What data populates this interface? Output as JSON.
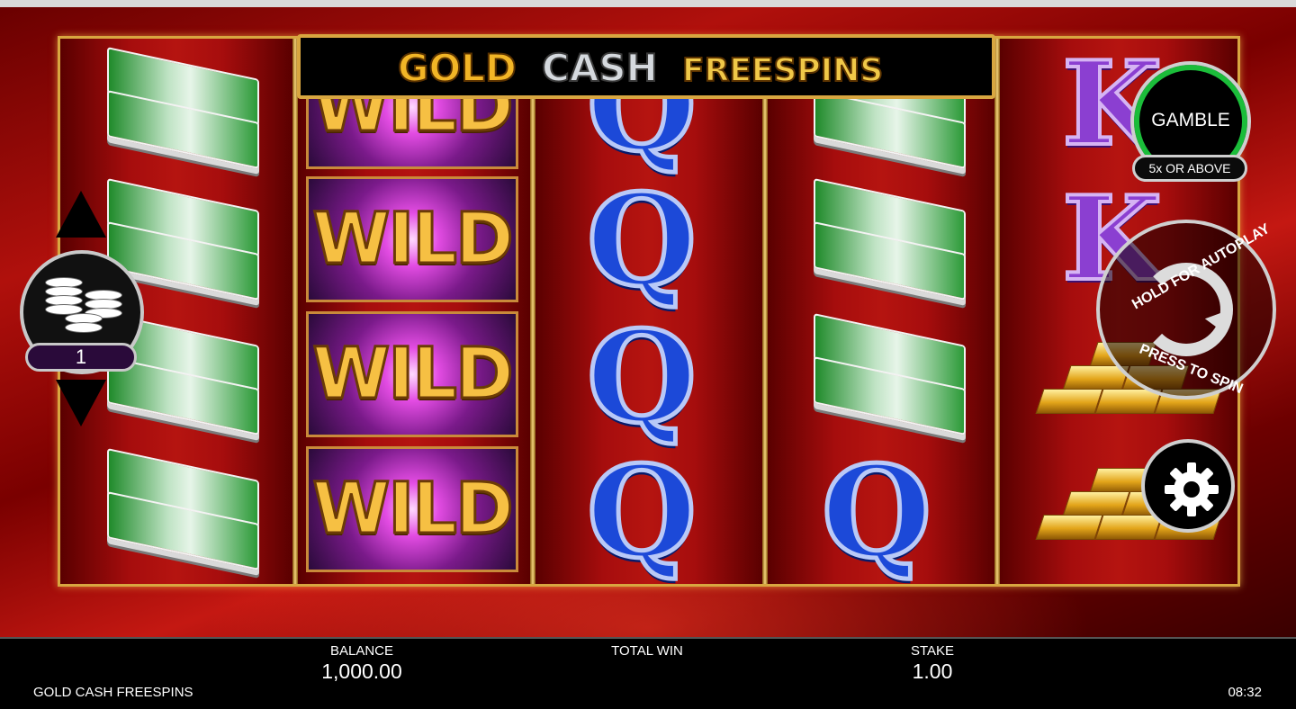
{
  "banner": {
    "word1": "GOLD",
    "word2": "CASH",
    "word3": "FREESPINS"
  },
  "reels": [
    [
      "cash",
      "cash",
      "cash",
      "cash"
    ],
    [
      "wild",
      "wild",
      "wild",
      "wild"
    ],
    [
      "q",
      "q",
      "q",
      "q"
    ],
    [
      "cash",
      "cash",
      "cash",
      "q"
    ],
    [
      "k",
      "k",
      "gold",
      "gold"
    ]
  ],
  "symbols": {
    "wild_label": "WILD",
    "q_label": "Q",
    "k_label": "K"
  },
  "controls": {
    "stake_selector_value": "1",
    "gamble_label": "GAMBLE",
    "gamble_sub": "5x OR ABOVE",
    "spin_top_text": "HOLD FOR AUTOPLAY",
    "spin_bottom_text": "PRESS TO SPIN"
  },
  "footer": {
    "balance_label": "BALANCE",
    "balance_value": "1,000.00",
    "total_win_label": "TOTAL WIN",
    "total_win_value": "",
    "stake_label": "STAKE",
    "stake_value": "1.00",
    "game_name": "GOLD CASH FREESPINS",
    "clock": "08:32"
  },
  "colors": {
    "frame_gold": "#d8a640",
    "bg_red": "#b0100c",
    "gamble_green": "#1bbd3a"
  }
}
